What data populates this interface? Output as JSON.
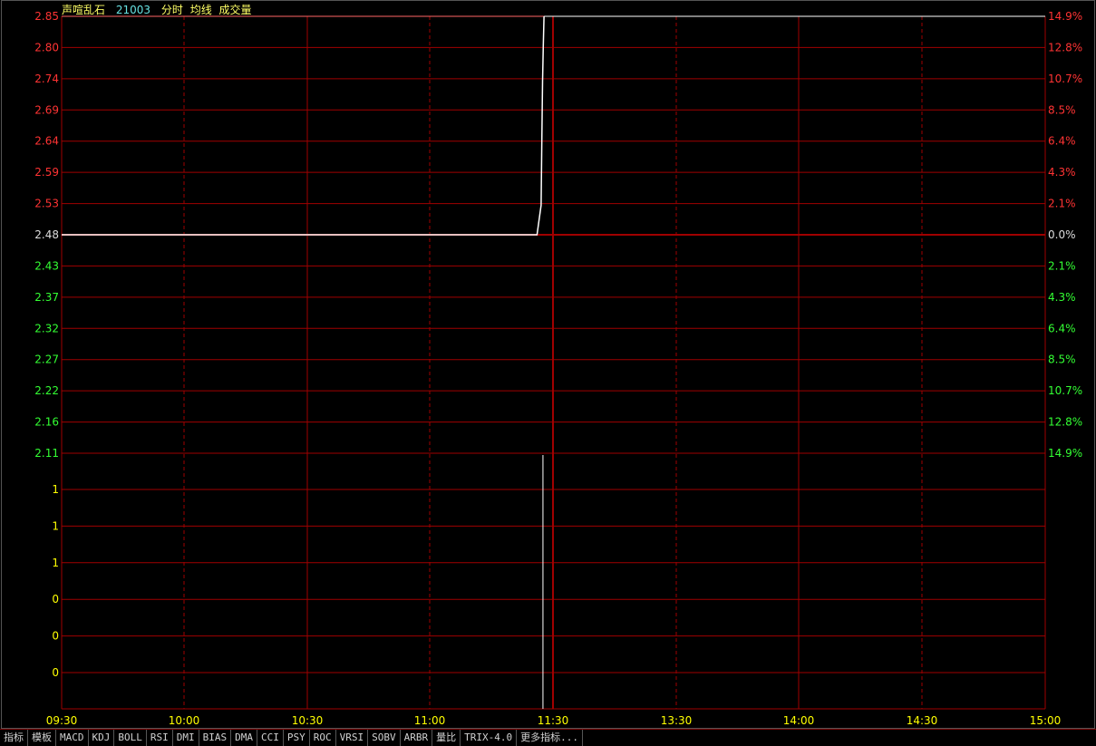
{
  "header": {
    "stock_name": "声喧乱石",
    "stock_code": "21003",
    "tags": [
      "分时",
      "均线",
      "成交量"
    ]
  },
  "colors": {
    "up": "#ff3333",
    "down": "#33ff33",
    "neutral": "#dddddd",
    "grid": "#a00000",
    "price_line": "#ffffff",
    "avg_line": "#ffff00",
    "time_label": "#ffff00",
    "volume_label": "#ffff00"
  },
  "chart_data": {
    "type": "line",
    "x_ticks": [
      "09:30",
      "10:00",
      "10:30",
      "11:00",
      "11:30",
      "13:30",
      "14:00",
      "14:30",
      "15:00"
    ],
    "y_price_ticks": [
      "2.85",
      "2.80",
      "2.74",
      "2.69",
      "2.64",
      "2.59",
      "2.53",
      "2.48",
      "2.43",
      "2.37",
      "2.32",
      "2.27",
      "2.22",
      "2.16",
      "2.11"
    ],
    "y_percent_ticks": [
      "14.9%",
      "12.8%",
      "10.7%",
      "8.5%",
      "6.4%",
      "4.3%",
      "2.1%",
      "0.0%",
      "2.1%",
      "4.3%",
      "6.4%",
      "8.5%",
      "10.7%",
      "12.8%",
      "14.9%"
    ],
    "y_volume_ticks": [
      "1",
      "1",
      "1",
      "0",
      "0",
      "0"
    ],
    "ylim": [
      2.11,
      2.85
    ],
    "prev_close": 2.48,
    "price_series": {
      "x": [
        "09:30",
        "11:26",
        "11:27",
        "11:27",
        "11:27",
        "11:27",
        "11:27"
      ],
      "y": [
        2.48,
        2.48,
        2.53,
        2.64,
        2.74,
        2.8,
        2.85
      ]
    },
    "volume_series": {
      "x": [
        "11:27"
      ],
      "y": [
        1
      ]
    },
    "grid": true
  },
  "tabs": [
    "指标",
    "模板",
    "MACD",
    "KDJ",
    "BOLL",
    "RSI",
    "DMI",
    "BIAS",
    "DMA",
    "CCI",
    "PSY",
    "ROC",
    "VRSI",
    "SOBV",
    "ARBR",
    "量比",
    "TRIX-4.0",
    "更多指标..."
  ]
}
